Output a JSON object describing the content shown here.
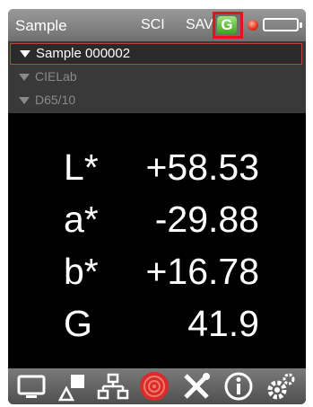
{
  "header": {
    "title": "Sample",
    "mode": "SCI",
    "save": "SAV",
    "gloss_indicator": "G",
    "status_dot_color": "#e43018",
    "battery_icon": "battery-icon"
  },
  "tree": [
    {
      "label": "Sample 000002",
      "selected": true
    },
    {
      "label": "CIELab",
      "selected": false
    },
    {
      "label": "D65/10",
      "selected": false
    }
  ],
  "measurements": [
    {
      "key": "L*",
      "value": "+58.53"
    },
    {
      "key": "a*",
      "value": "-29.88"
    },
    {
      "key": "b*",
      "value": "+16.78"
    },
    {
      "key": "G",
      "value": "41.9"
    }
  ],
  "toolbar": {
    "items": [
      {
        "icon": "monitor-icon"
      },
      {
        "icon": "shapes-icon"
      },
      {
        "icon": "hierarchy-icon"
      },
      {
        "icon": "target-icon"
      },
      {
        "icon": "tools-icon"
      },
      {
        "icon": "info-icon"
      },
      {
        "icon": "settings-icon"
      }
    ]
  },
  "colors": {
    "highlight": "#e8101a",
    "gloss_green": "#3da31f",
    "target_red": "#d92b2b"
  }
}
